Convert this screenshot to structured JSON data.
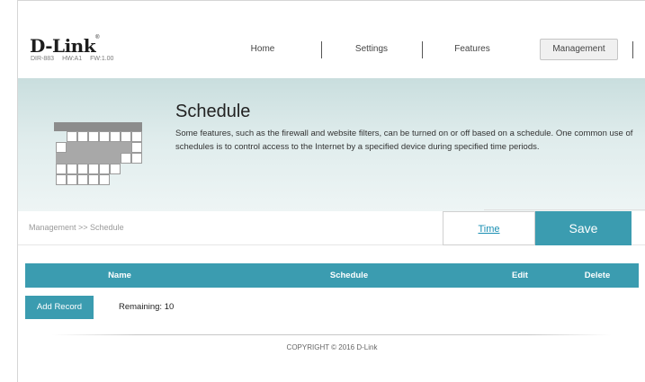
{
  "header": {
    "logo": "D-Link",
    "model": "DIR-883",
    "hw": "HW:A1",
    "fw": "FW:1.00"
  },
  "nav": {
    "items": [
      {
        "label": "Home",
        "active": false
      },
      {
        "label": "Settings",
        "active": false
      },
      {
        "label": "Features",
        "active": false
      },
      {
        "label": "Management",
        "active": true
      }
    ]
  },
  "banner": {
    "title": "Schedule",
    "description": "Some features, such as the firewall and website filters, can be turned on or off based on a schedule. One common use of schedules is to control access to the Internet by a specified device during specified time periods.",
    "icon": "calendar-icon"
  },
  "breadcrumb": "Management >> Schedule",
  "actions": {
    "time_label": "Time",
    "save_label": "Save"
  },
  "table": {
    "columns": [
      "Name",
      "Schedule",
      "Edit",
      "Delete"
    ],
    "rows": []
  },
  "add_record_label": "Add Record",
  "remaining": "Remaining: 10",
  "footer": "COPYRIGHT © 2016 D-Link",
  "colors": {
    "accent": "#3b9cb0",
    "link": "#1a8fb3"
  }
}
